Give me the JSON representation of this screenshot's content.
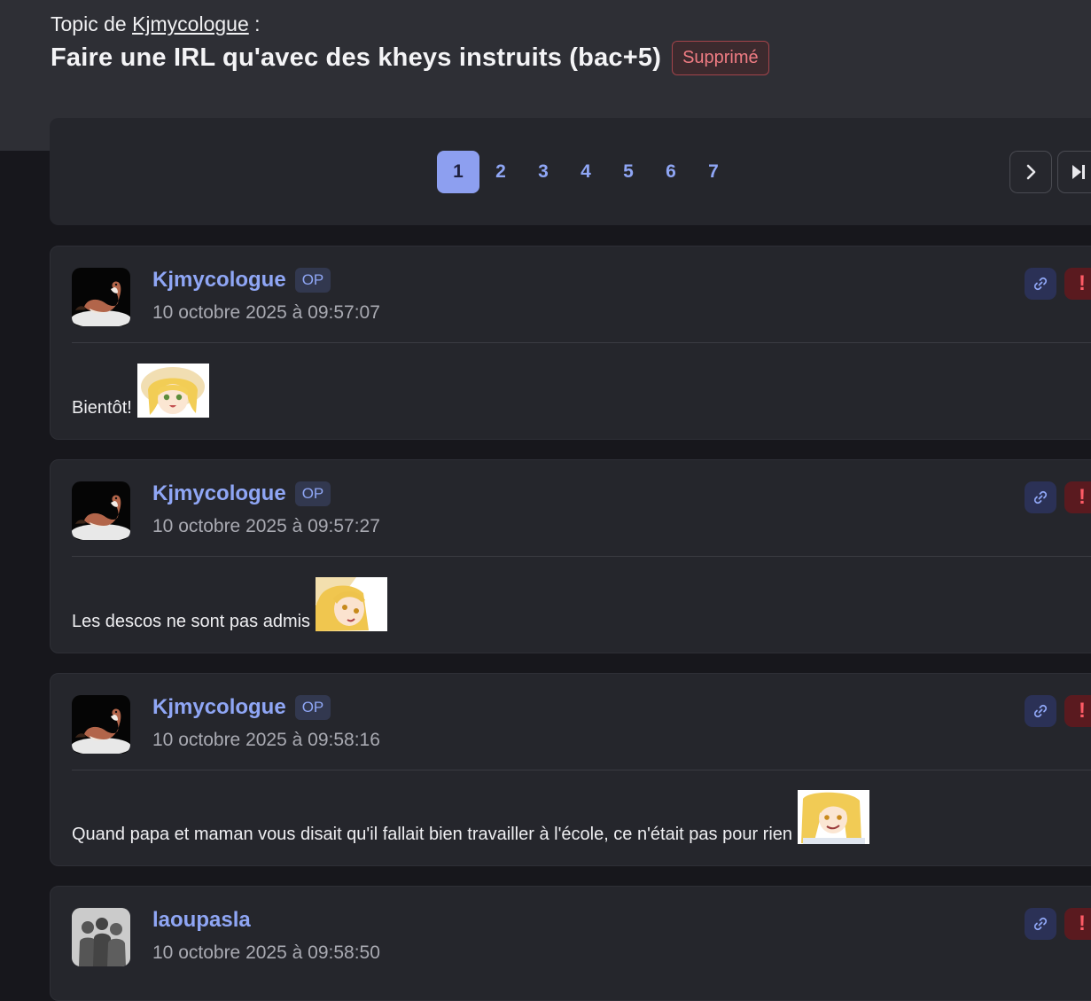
{
  "header": {
    "topic_prefix": "Topic de",
    "topic_author": "Kjmycologue",
    "topic_suffix": ":",
    "title": "Faire une IRL qu'avec des kheys instruits (bac+5)",
    "status_badge": "Supprimé"
  },
  "pagination": {
    "pages": [
      "1",
      "2",
      "3",
      "4",
      "5",
      "6",
      "7"
    ],
    "current": "1",
    "next_icon": "chevron-right-icon",
    "last_icon": "skip-to-last-icon"
  },
  "posts": [
    {
      "author": "Kjmycologue",
      "op_label": "OP",
      "date": "10 octobre 2025 à 09:57:07",
      "text": "Bientôt!",
      "avatar": "stoat-avatar",
      "sticker": "anime-girl-hat-sticker"
    },
    {
      "author": "Kjmycologue",
      "op_label": "OP",
      "date": "10 octobre 2025 à 09:57:27",
      "text": "Les descos ne sont pas admis",
      "avatar": "stoat-avatar",
      "sticker": "anime-girl-tilted-sticker"
    },
    {
      "author": "Kjmycologue",
      "op_label": "OP",
      "date": "10 octobre 2025 à 09:58:16",
      "text": "Quand papa et maman vous disait qu'il fallait bien travailler à l'école, ce n'était pas pour rien",
      "avatar": "stoat-avatar",
      "sticker": "anime-girl-smirk-sticker"
    },
    {
      "author": "laoupasla",
      "date": "10 octobre 2025 à 09:58:50",
      "avatar": "grey-silhouettes-avatar"
    }
  ],
  "post_actions": {
    "link_icon": "link-icon",
    "report_icon": "report-icon",
    "report_glyph": "!"
  }
}
